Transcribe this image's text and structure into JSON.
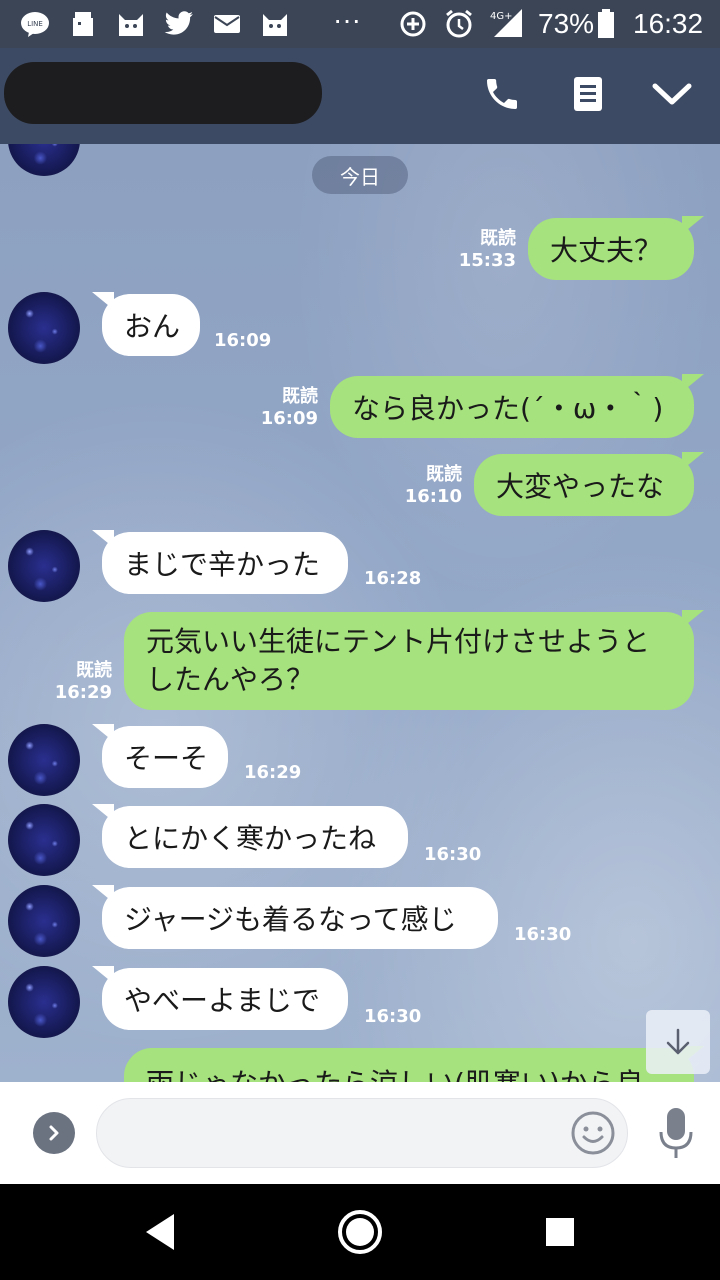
{
  "status_bar": {
    "icons": [
      "line-icon",
      "box-icon",
      "cat-icon",
      "twitter-icon",
      "mail-icon",
      "cat-icon",
      "more-icon",
      "data-saver-icon",
      "alarm-icon",
      "signal-icon",
      "battery-icon"
    ],
    "network": "4G+",
    "battery": "73%",
    "clock": "16:32",
    "more": "···"
  },
  "header": {
    "contact_name_redacted": true
  },
  "chat": {
    "date_label": "今日",
    "messages": [
      {
        "side": "out",
        "text": "大丈夫？",
        "read": "既読",
        "time": "15:33"
      },
      {
        "side": "in",
        "text": "おん",
        "time": "16:09"
      },
      {
        "side": "out",
        "text": "なら良かった(´・ω・｀)",
        "read": "既読",
        "time": "16:09"
      },
      {
        "side": "out",
        "text": "大変やったな",
        "read": "既読",
        "time": "16:10"
      },
      {
        "side": "in",
        "text": "まじで辛かった",
        "time": "16:28"
      },
      {
        "side": "out",
        "text": "元気いい生徒にテント片付けさせようとしたんやろ？",
        "read": "既読",
        "time": "16:29"
      },
      {
        "side": "in",
        "text": "そーそ",
        "time": "16:29"
      },
      {
        "side": "in",
        "text": "とにかく寒かったね",
        "time": "16:30"
      },
      {
        "side": "in",
        "text": "ジャージも着るなって感じ",
        "time": "16:30"
      },
      {
        "side": "in",
        "text": "やべーよまじで",
        "time": "16:30"
      },
      {
        "side": "out",
        "text": "雨じゃなかったら涼しい(肌寒い)から良",
        "partial": true
      }
    ]
  },
  "input": {
    "placeholder": "",
    "value": ""
  },
  "colors": {
    "header_bg": "#3d4a63",
    "status_bg": "#3b4556",
    "outgoing_bubble": "#a6e27d",
    "incoming_bubble": "#ffffff",
    "chat_bg": "#8fa3c4"
  }
}
